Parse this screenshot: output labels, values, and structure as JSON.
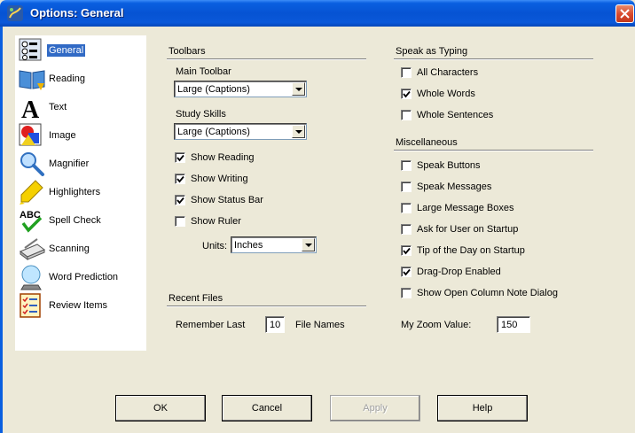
{
  "window": {
    "title": "Options: General"
  },
  "nav": {
    "items": [
      {
        "label": "General",
        "icon": "general-icon",
        "selected": true
      },
      {
        "label": "Reading",
        "icon": "book-icon"
      },
      {
        "label": "Text",
        "icon": "text-icon"
      },
      {
        "label": "Image",
        "icon": "image-icon"
      },
      {
        "label": "Magnifier",
        "icon": "magnifier-icon"
      },
      {
        "label": "Highlighters",
        "icon": "highlighter-icon"
      },
      {
        "label": "Spell Check",
        "icon": "spell-check-icon"
      },
      {
        "label": "Scanning",
        "icon": "scanner-icon"
      },
      {
        "label": "Word Prediction",
        "icon": "crystal-ball-icon"
      },
      {
        "label": "Review Items",
        "icon": "checklist-icon"
      }
    ]
  },
  "toolbars": {
    "title": "Toolbars",
    "main_toolbar_label": "Main Toolbar",
    "main_toolbar_value": "Large (Captions)",
    "study_skills_label": "Study Skills",
    "study_skills_value": "Large (Captions)",
    "checkboxes": [
      {
        "label": "Show Reading",
        "checked": true
      },
      {
        "label": "Show Writing",
        "checked": true
      },
      {
        "label": "Show Status Bar",
        "checked": true
      },
      {
        "label": "Show Ruler",
        "checked": false
      }
    ],
    "units_label": "Units:",
    "units_value": "Inches"
  },
  "recent_files": {
    "title": "Recent Files",
    "remember_label": "Remember Last",
    "count": "10",
    "suffix": "File Names"
  },
  "speak_as_typing": {
    "title": "Speak as Typing",
    "checkboxes": [
      {
        "label": "All Characters",
        "checked": false
      },
      {
        "label": "Whole Words",
        "checked": true
      },
      {
        "label": "Whole Sentences",
        "checked": false
      }
    ]
  },
  "misc": {
    "title": "Miscellaneous",
    "checkboxes": [
      {
        "label": "Speak Buttons",
        "checked": false
      },
      {
        "label": "Speak Messages",
        "checked": false
      },
      {
        "label": "Large Message Boxes",
        "checked": false
      },
      {
        "label": "Ask for User on Startup",
        "checked": false
      },
      {
        "label": "Tip of the Day on Startup",
        "checked": true
      },
      {
        "label": "Drag-Drop Enabled",
        "checked": true
      },
      {
        "label": "Show Open Column Note Dialog",
        "checked": false
      }
    ],
    "zoom_label": "My Zoom Value:",
    "zoom_value": "150"
  },
  "buttons": {
    "ok": "OK",
    "cancel": "Cancel",
    "apply": "Apply",
    "help": "Help"
  },
  "colors": {
    "titlebar": "#0653d3",
    "selection": "#316ac5",
    "dialog": "#ece9d8"
  }
}
